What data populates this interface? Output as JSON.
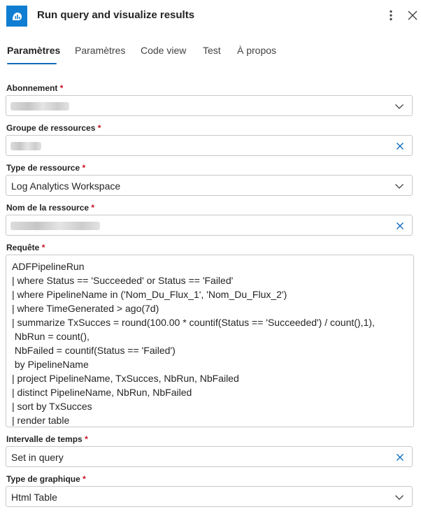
{
  "header": {
    "title": "Run query and visualize results",
    "icon": "analytics-icon",
    "accent": "#0f7dd1"
  },
  "tabs": [
    {
      "label": "Paramètres",
      "active": true
    },
    {
      "label": "Paramètres",
      "active": false
    },
    {
      "label": "Code view",
      "active": false
    },
    {
      "label": "Test",
      "active": false
    },
    {
      "label": "À propos",
      "active": false
    }
  ],
  "form": {
    "subscription": {
      "label": "Abonnement",
      "required_mark": "*"
    },
    "resource_group": {
      "label": "Groupe de ressources",
      "required_mark": "*"
    },
    "resource_type": {
      "label": "Type de ressource",
      "required_mark": "*",
      "value": "Log Analytics Workspace"
    },
    "resource_name": {
      "label": "Nom de la ressource",
      "required_mark": "*"
    },
    "query": {
      "label": "Requête",
      "required_mark": "*",
      "lines": [
        "ADFPipelineRun",
        "| where Status == 'Succeeded' or Status == 'Failed'",
        "| where PipelineName in ('Nom_Du_Flux_1', 'Nom_Du_Flux_2')",
        "| where TimeGenerated > ago(7d)",
        "| summarize TxSucces = round(100.00 * countif(Status == 'Succeeded') / count(),1),",
        " NbRun = count(),",
        " NbFailed = countif(Status == 'Failed')",
        " by PipelineName",
        "| project PipelineName, TxSucces, NbRun, NbFailed",
        "| distinct PipelineName, NbRun, NbFailed",
        "| sort by TxSucces",
        "| render table"
      ]
    },
    "time_range": {
      "label": "Intervalle de temps",
      "required_mark": "*",
      "value": "Set in query"
    },
    "chart_type": {
      "label": "Type de graphique",
      "required_mark": "*",
      "value": "Html Table"
    }
  },
  "colors": {
    "required": "#c50f1f",
    "clear_icon": "#0f6cbd",
    "tab_underline": "#0f6cbd"
  }
}
